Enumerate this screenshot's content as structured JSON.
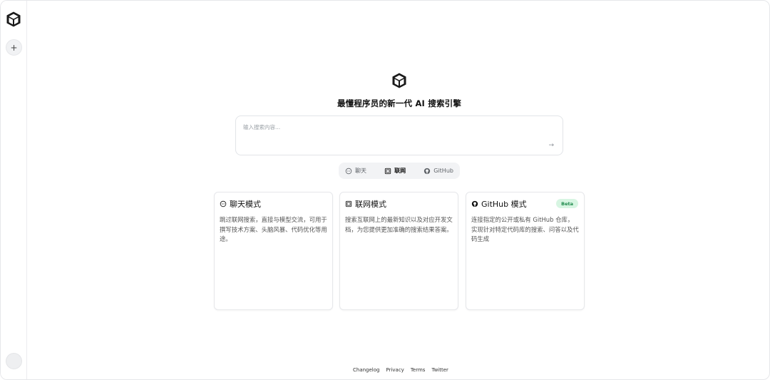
{
  "sidebar": {
    "logo_icon": "cube-logo-icon",
    "new_button_label": "+"
  },
  "hero": {
    "logo_icon": "cube-logo-icon",
    "headline": "最懂程序员的新一代 AI 搜索引擎"
  },
  "search": {
    "placeholder": "输入搜索内容...",
    "value": "",
    "submit_icon": "→"
  },
  "mode_tabs": [
    {
      "label": "聊天",
      "icon": "chat-bubble-icon",
      "active": false
    },
    {
      "label": "联网",
      "icon": "web-icon",
      "active": true
    },
    {
      "label": "GitHub",
      "icon": "github-icon",
      "active": false
    }
  ],
  "cards": [
    {
      "title": "聊天模式",
      "icon": "chat-bubble-icon",
      "description": "跳过联网搜索，直接与模型交流，可用于撰写技术方案、头脑风暴、代码优化等用途。"
    },
    {
      "title": "联网模式",
      "icon": "web-icon",
      "description": "搜索互联网上的最新知识以及对应开发文档，为您提供更加准确的搜索结果答案。"
    },
    {
      "title": "GitHub 模式",
      "icon": "github-icon",
      "badge": "Beta",
      "description": "连接指定的公开或私有 GitHub 仓库，实现针对特定代码库的搜索、问答以及代码生成"
    }
  ],
  "footer": {
    "links": [
      "Changelog",
      "Privacy",
      "Terms",
      "Twitter"
    ]
  },
  "colors": {
    "badge_bg": "#d7f5e2",
    "badge_text": "#1f8a4c",
    "border": "#e6e7ea",
    "tab_bg": "#f2f3f5"
  }
}
